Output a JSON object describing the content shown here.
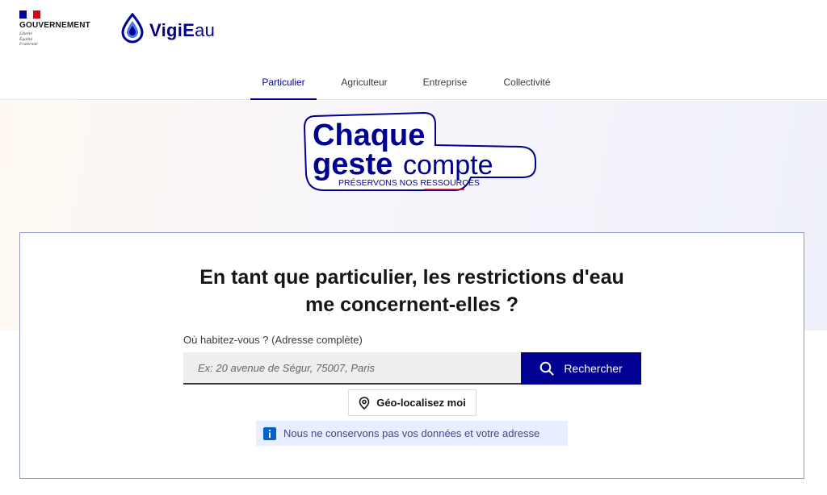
{
  "header": {
    "gov": {
      "name": "GOUVERNEMENT",
      "motto": [
        "Liberté",
        "Égalité",
        "Fraternité"
      ],
      "flag_colors": [
        "#000091",
        "#ffffff",
        "#e1000f"
      ]
    },
    "brand": {
      "name_strong": "VigiE",
      "name_rest": "au",
      "icon": "water-drop-icon"
    }
  },
  "nav": {
    "items": [
      {
        "label": "Particulier",
        "active": true
      },
      {
        "label": "Agriculteur",
        "active": false
      },
      {
        "label": "Entreprise",
        "active": false
      },
      {
        "label": "Collectivité",
        "active": false
      }
    ]
  },
  "campaign": {
    "line1": "Chaque",
    "line2_bold": "geste",
    "line2_light": "compte",
    "tagline": "PRÉSERVONS NOS RESSOURCES"
  },
  "search": {
    "question_line1": "En tant que particulier, les restrictions d'eau",
    "question_line2": "me concernent-elles ?",
    "label": "Où habitez-vous ? (Adresse complète)",
    "placeholder": "Ex: 20 avenue de Ségur, 75007, Paris",
    "value": "",
    "button_label": "Rechercher",
    "button_icon": "search-icon",
    "geo_label": "Géo-localisez moi",
    "geo_icon": "location-pin-icon",
    "notice": "Nous ne conservons pas vos données et votre adresse",
    "notice_icon": "info-icon"
  },
  "colors": {
    "primary": "#000091",
    "notice_bg": "#e8edff",
    "card_border": "#8f9bd1",
    "accent_red": "#e1000f"
  }
}
